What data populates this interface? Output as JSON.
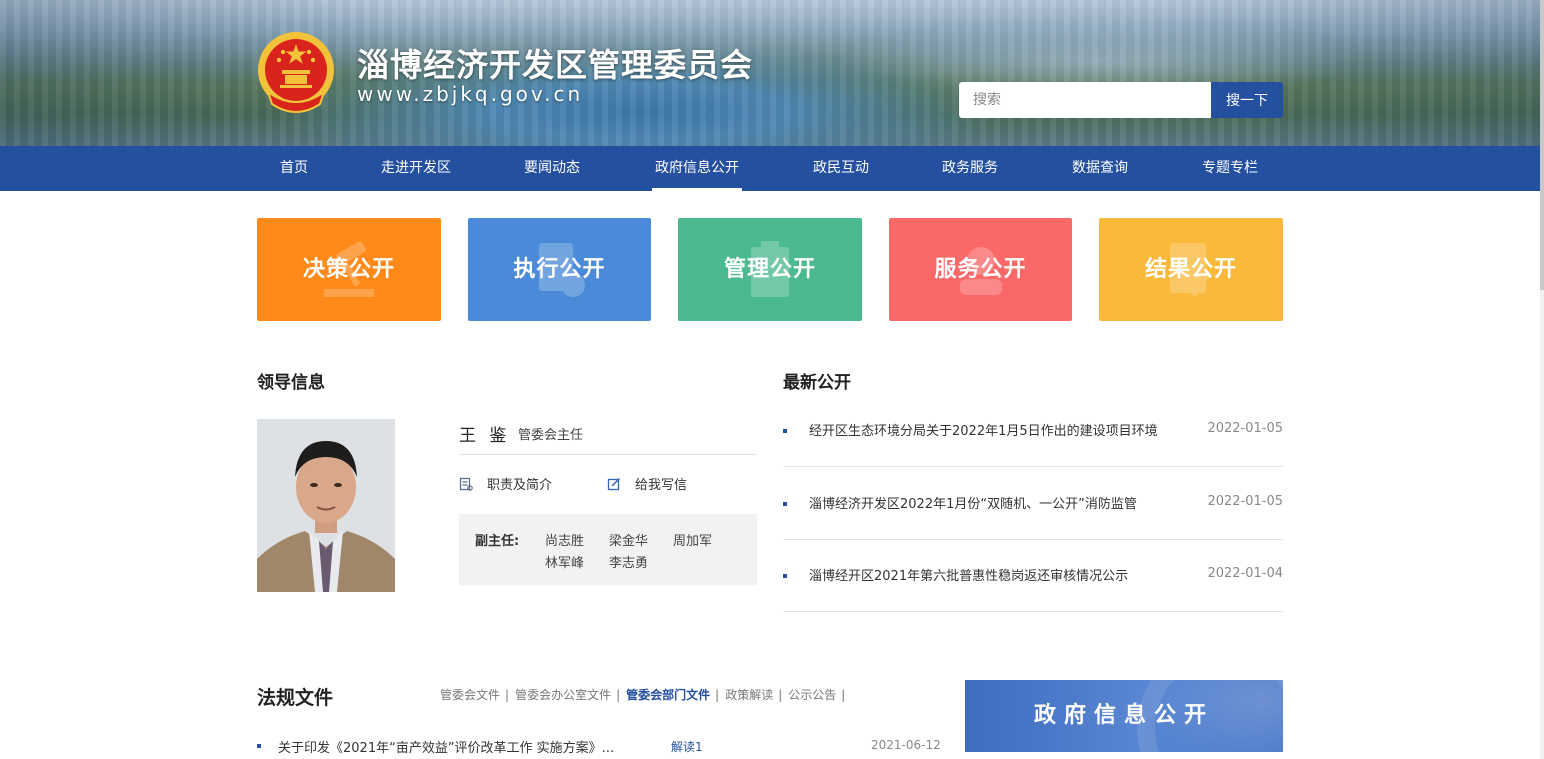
{
  "header": {
    "title": "淄博经济开发区管理委员会",
    "url": "www.zbjkq.gov.cn",
    "search_placeholder": "搜索",
    "search_button": "搜一下"
  },
  "nav": {
    "items": [
      "首页",
      "走进开发区",
      "要闻动态",
      "政府信息公开",
      "政民互动",
      "政务服务",
      "数据查询",
      "专题专栏"
    ],
    "active_index": 3
  },
  "cards": [
    {
      "label": "决策公开",
      "color": "#ff8a1a"
    },
    {
      "label": "执行公开",
      "color": "#4a8ad8"
    },
    {
      "label": "管理公开",
      "color": "#4cba8f"
    },
    {
      "label": "服务公开",
      "color": "#fb6868"
    },
    {
      "label": "结果公开",
      "color": "#fbb93c"
    }
  ],
  "leader_section": {
    "title": "领导信息",
    "name": "王 鉴",
    "role": "管委会主任",
    "links": [
      "职责及简介",
      "给我写信"
    ],
    "deputy_label": "副主任:",
    "deputies": [
      "尚志胜",
      "梁金华",
      "周加军",
      "林军峰",
      "李志勇"
    ]
  },
  "latest_section": {
    "title": "最新公开",
    "items": [
      {
        "title": "经开区生态环境分局关于2022年1月5日作出的建设项目环境",
        "date": "2022-01-05"
      },
      {
        "title": "淄博经济开发区2022年1月份“双随机、一公开”消防监管",
        "date": "2022-01-05"
      },
      {
        "title": "淄博经开区2021年第六批普惠性稳岗返还审核情况公示",
        "date": "2022-01-04"
      }
    ]
  },
  "laws_section": {
    "title": "法规文件",
    "tabs": [
      "管委会文件",
      "管委会办公室文件",
      "管委会部门文件",
      "政策解读",
      "公示公告"
    ],
    "active_tab": 2,
    "separator": "|",
    "items": [
      {
        "title": "关于印发《2021年“亩产效益”评价改革工作 实施方案》...",
        "read": "解读1",
        "date": "2021-06-12"
      }
    ]
  },
  "promo": {
    "label": "政府信息公开"
  },
  "colors": {
    "brand": "#2550a0",
    "emblem_red": "#d8241c",
    "emblem_gold": "#f2c23a"
  }
}
